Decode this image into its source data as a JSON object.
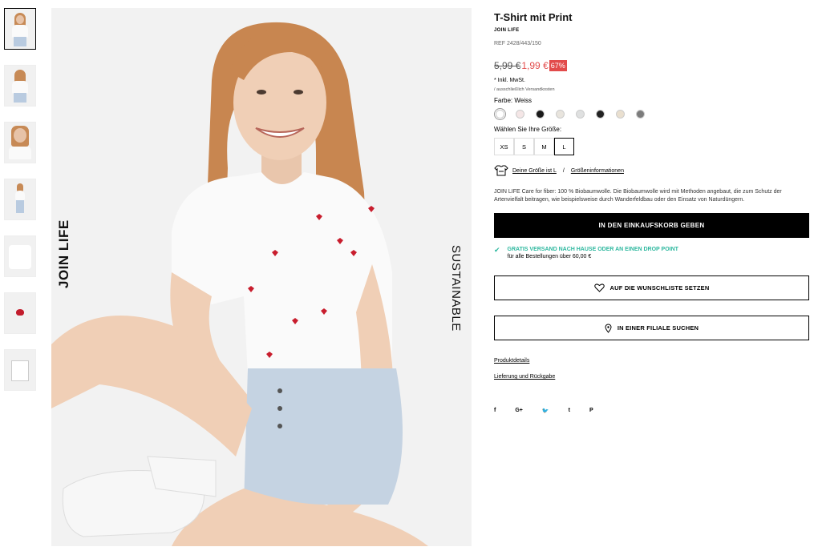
{
  "product": {
    "title": "T-Shirt mit Print",
    "brand": "JOIN LIFE",
    "ref": "REF 2428/443/150",
    "price_old": "5,99 €",
    "price_new": "1,99 €",
    "discount": "67%",
    "tax_note": "* Inkl. MwSt.",
    "shipping_note": "/ ausschließlich Versandkosten",
    "color_label": "Farbe: Weiss",
    "size_label": "Wählen Sie Ihre Größe:",
    "sizes": [
      "XS",
      "S",
      "M",
      "L"
    ],
    "selected_size": "L",
    "fit_link": "Deine Größe ist L",
    "fit_sep": "/",
    "size_info_link": "Größeninformationen",
    "description": "JOIN LIFE Care for fiber: 100 % Biobaumwolle. Die Biobaumwolle wird mit Methoden angebaut, die zum Schutz der Artenvielfalt beitragen, wie beispielsweise durch Wanderfeldbau oder den Einsatz von Naturdüngern.",
    "add_to_cart": "IN DEN EINKAUFSKORB GEBEN",
    "free_shipping_title": "GRATIS VERSAND NACH HAUSE ODER AN EINEN DROP POINT",
    "free_shipping_sub": "für alle Bestellungen über 60,00 €",
    "wishlist": "AUF DIE WUNSCHLISTE SETZEN",
    "store_search": "IN EINER FILIALE SUCHEN",
    "details_link": "Produktdetails",
    "delivery_link": "Lieferung und Rückgabe",
    "social": [
      "f",
      "G+",
      "🐦",
      "t",
      "P"
    ],
    "swatch_colors": [
      "#ffffff",
      "#f4e6e6",
      "#1a1a1a",
      "#e8e4dd",
      "#dfe0e0",
      "#222222",
      "#e9dfcf",
      "#7c7c7c"
    ]
  },
  "hero": {
    "left_label": "JOIN LIFE",
    "right_label": "SUSTAINABLE"
  }
}
